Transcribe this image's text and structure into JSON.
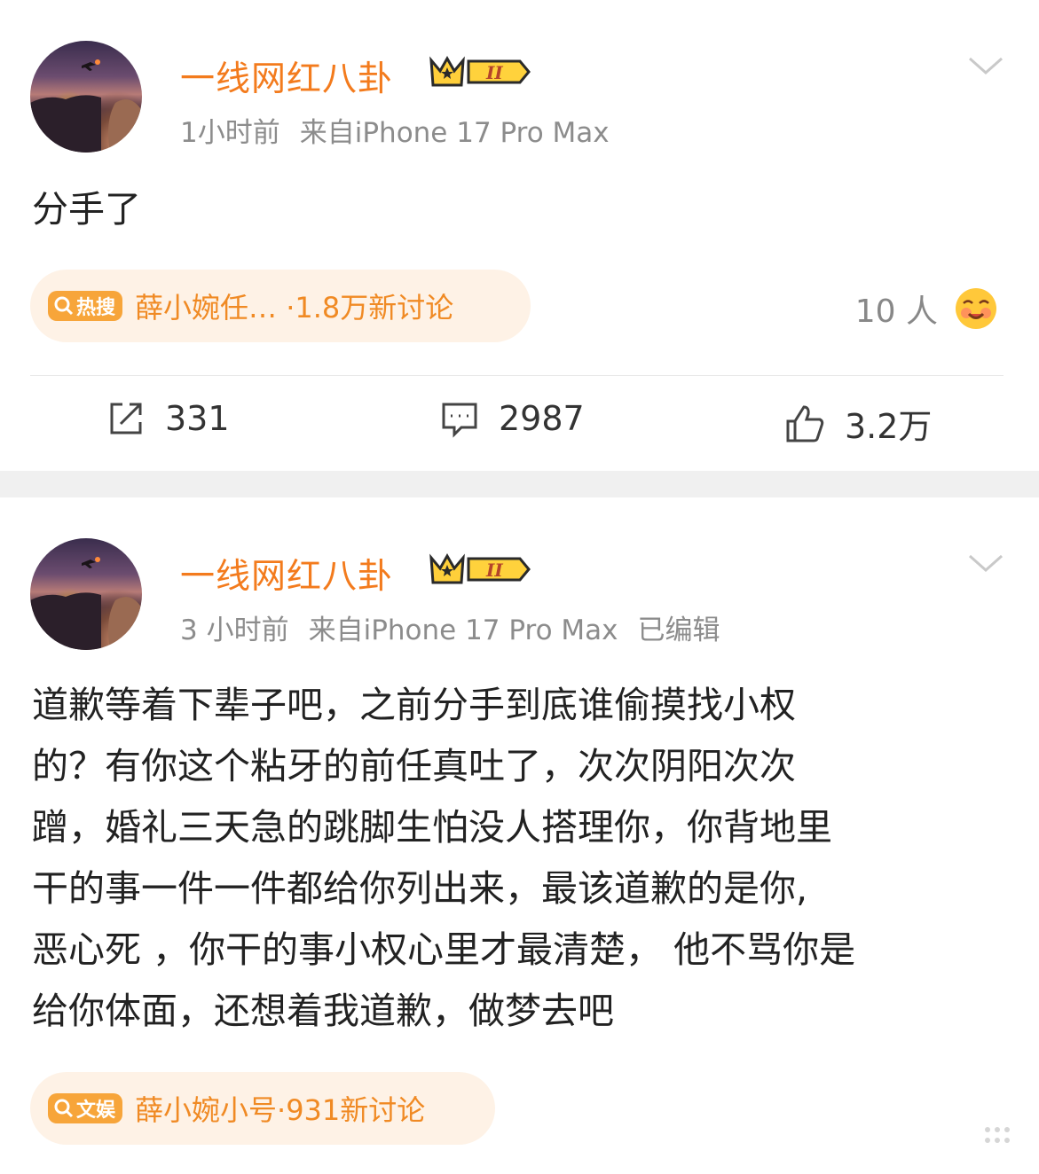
{
  "posts": [
    {
      "author": "一线网红八卦",
      "vip_level": "II",
      "time": "1小时前",
      "source": "来自iPhone 17 Pro Max",
      "edited": "",
      "text_lines": [
        "分手了"
      ],
      "topic": {
        "badge": "热搜",
        "text": "薛小婉任… ·1.8万新讨论"
      },
      "reaction_count": "10 人",
      "actions": {
        "repost": "331",
        "comment": "2987",
        "like": "3.2万"
      }
    },
    {
      "author": "一线网红八卦",
      "vip_level": "II",
      "time": "3 小时前",
      "source": "来自iPhone 17 Pro Max",
      "edited": "已编辑",
      "text_lines": [
        "道歉等着下辈子吧，之前分手到底谁偷摸找小权",
        "的？有你这个粘牙的前任真吐了，次次阴阳次次",
        "蹭，婚礼三天急的跳脚生怕没人搭理你，你背地里",
        "干的事一件一件都给你列出来，最该道歉的是你,",
        "恶心死 ，你干的事小权心里才最清楚， 他不骂你是",
        "给你体面，还想着我道歉，做梦去吧"
      ],
      "topic": {
        "badge": "文娱",
        "text": "薛小婉小号·931新讨论"
      }
    }
  ],
  "colors": {
    "accent": "#f37b1d",
    "meta": "#8c8c8c",
    "pill_bg": "#fef2e6",
    "badge": "#f7a53a"
  },
  "icons": [
    "vip-crown-icon",
    "chevron-down-icon",
    "search-icon",
    "repost-icon",
    "comment-icon",
    "like-icon",
    "reaction-emoji-icon"
  ]
}
